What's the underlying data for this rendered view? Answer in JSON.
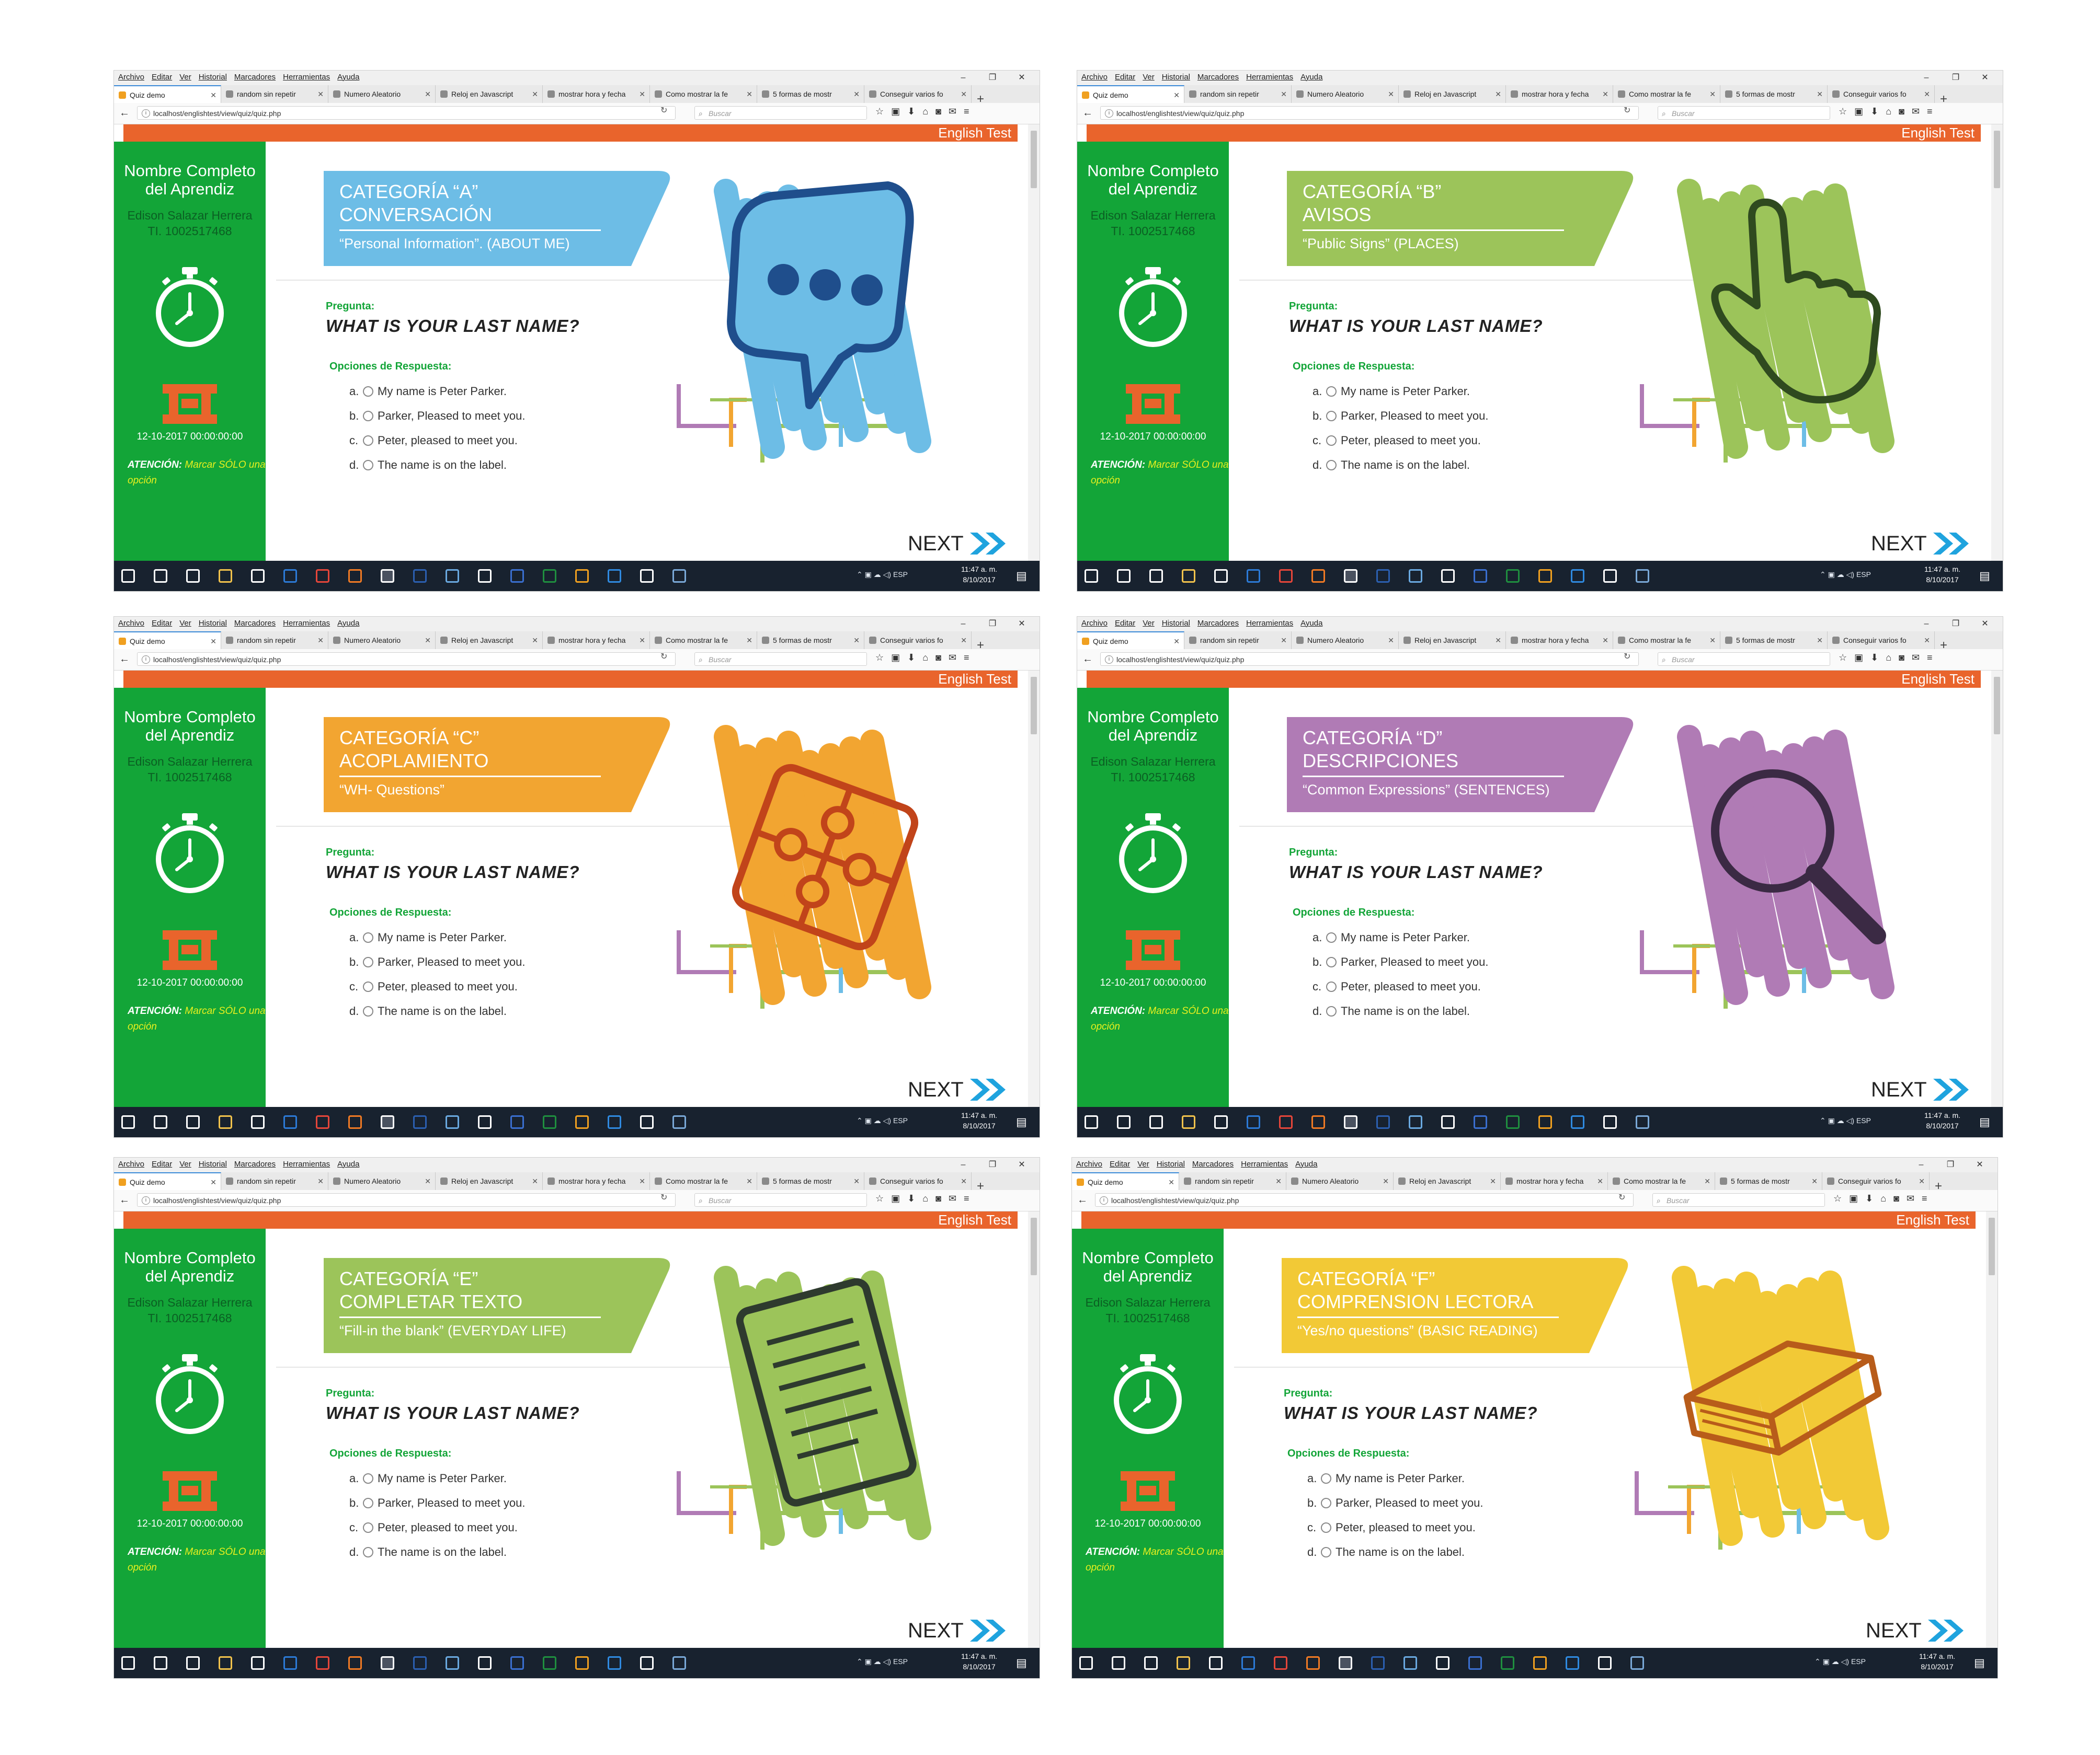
{
  "menu": [
    "Archivo",
    "Editar",
    "Ver",
    "Historial",
    "Marcadores",
    "Herramientas",
    "Ayuda"
  ],
  "window_controls": [
    "–",
    "❐",
    "✕"
  ],
  "tabs": [
    "Quiz demo",
    "random sin repetir",
    "Numero Aleatorio",
    "Reloj en Javascript",
    "mostrar hora y fecha",
    "Como mostrar la fe",
    "5 formas de mostr",
    "Conseguir varios fo"
  ],
  "tab_new": "+",
  "url": "localhost/englishtest/view/quiz/quiz.php",
  "search_placeholder": "Buscar",
  "brand": "English Test",
  "sidebar": {
    "label": "Nombre Completo del Aprendiz",
    "name": "Edison Salazar Herrera",
    "id": "TI. 1002517468",
    "date": "12-10-2017 00:00:00:00",
    "warning_bold": "ATENCIÓN:",
    "warning_rest": "Marcar SÓLO una opción"
  },
  "question": {
    "label": "Pregunta:",
    "text": "WHAT IS YOUR LAST NAME?",
    "options_label": "Opciones de Respuesta:",
    "options": [
      {
        "letter": "a.",
        "text": "My name is Peter Parker."
      },
      {
        "letter": "b.",
        "text": "Parker, Pleased to meet you."
      },
      {
        "letter": "c.",
        "text": "Peter, pleased to meet you."
      },
      {
        "letter": "d.",
        "text": "The name is on the label."
      }
    ]
  },
  "next_label": "NEXT",
  "tray": {
    "lang": "ESP",
    "time": "11:47 a. m.",
    "date": "8/10/2017"
  },
  "panels": [
    {
      "cat_title": "CATEGORÍA “A”\nCONVERSACIÓN",
      "cat_subtitle": "“Personal Information”. (ABOUT ME)",
      "color": "#6dbde6",
      "art_stroke": "#1f4e8c",
      "icon": "speech-bubble-icon"
    },
    {
      "cat_title": "CATEGORÍA “B”\nAVISOS",
      "cat_subtitle": "“Public Signs” (PLACES)",
      "color": "#9cc45a",
      "art_stroke": "#2f4a1f",
      "icon": "pointing-hand-icon"
    },
    {
      "cat_title": "CATEGORÍA “C”\nACOPLAMIENTO",
      "cat_subtitle": "“WH- Questions”",
      "color": "#f2a531",
      "art_stroke": "#c1441a",
      "icon": "puzzle-icon"
    },
    {
      "cat_title": "CATEGORÍA “D”\nDESCRIPCIONES",
      "cat_subtitle": "“Common Expressions” (SENTENCES)",
      "color": "#b07bb5",
      "art_stroke": "#3b2a44",
      "icon": "magnifier-icon"
    },
    {
      "cat_title": "CATEGORÍA “E”\nCOMPLETAR TEXTO",
      "cat_subtitle": "“Fill-in the blank” (EVERYDAY LIFE)",
      "color": "#9cc45a",
      "art_stroke": "#2e3a2e",
      "icon": "document-icon"
    },
    {
      "cat_title": "CATEGORÍA “F”\nCOMPRENSION LECTORA",
      "cat_subtitle": "“Yes/no questions” (BASIC READING)",
      "color": "#f2c936",
      "art_stroke": "#b85c1a",
      "icon": "book-icon"
    }
  ],
  "decor_line_colors": [
    "#b07bb5",
    "#f2a531",
    "#9cc45a",
    "#6dbde6"
  ],
  "taskbar_icon_colors": [
    "#ffffff",
    "#ffffff",
    "#ffffff",
    "#f1c24c",
    "#ffffff",
    "#2c7ad6",
    "#e6463a",
    "#f07a24",
    "#ffffff",
    "#2b5fb0",
    "#6aa9e0",
    "#ffffff",
    "#3a6fd0",
    "#1f8f3f",
    "#f0a020",
    "#2f8ae0",
    "#ffffff",
    "#7aa9d8"
  ]
}
